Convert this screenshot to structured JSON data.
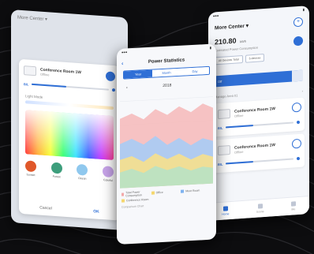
{
  "colors": {
    "accent": "#2f6fd6",
    "background": "#0d0d0f"
  },
  "left_phone": {
    "title": "More Center ▾",
    "device": {
      "name": "Conference Room 1W",
      "status": "Offline"
    },
    "brightness_label": "B/L",
    "light_mode_label": "Light Mode",
    "presets": [
      {
        "label": "Sunset",
        "color": "#e0582a"
      },
      {
        "label": "Forest",
        "color": "#3d9e7c"
      },
      {
        "label": "Ocean",
        "color": "#8fc8ee"
      },
      {
        "label": "Colorful",
        "color": "#c6a3e8"
      }
    ],
    "cancel_label": "Cancel",
    "ok_label": "OK"
  },
  "mid_phone": {
    "title": "Power Statistics",
    "segments": [
      "Year",
      "Month",
      "Day"
    ],
    "active_segment": 0,
    "year": "2018",
    "legend": [
      {
        "label": "Total Power Consumption",
        "color": "#f3a9a9"
      },
      {
        "label": "Office",
        "color": "#f5d76e"
      },
      {
        "label": "Meet Room",
        "color": "#7fb3f0"
      },
      {
        "label": "Conference Room",
        "color": "#f5d76e"
      }
    ],
    "footnote": "Comparison Chart"
  },
  "right_phone": {
    "title": "More Center ▾",
    "energy_value": "210.80",
    "energy_unit": "kWh",
    "energy_sub": "Estimated Power Consumption",
    "chips": [
      "All Devices Total",
      "5 devices"
    ],
    "bar_label": "Off",
    "section_label": "Manage Area 01",
    "devices": [
      {
        "name": "Conference Room 1W",
        "status": "Offline",
        "level_label": "B/L"
      },
      {
        "name": "Conference Room 1W",
        "status": "Offline",
        "level_label": "B/L"
      }
    ],
    "tabs": [
      "Home",
      "Scene",
      "Me"
    ],
    "active_tab": 0
  }
}
